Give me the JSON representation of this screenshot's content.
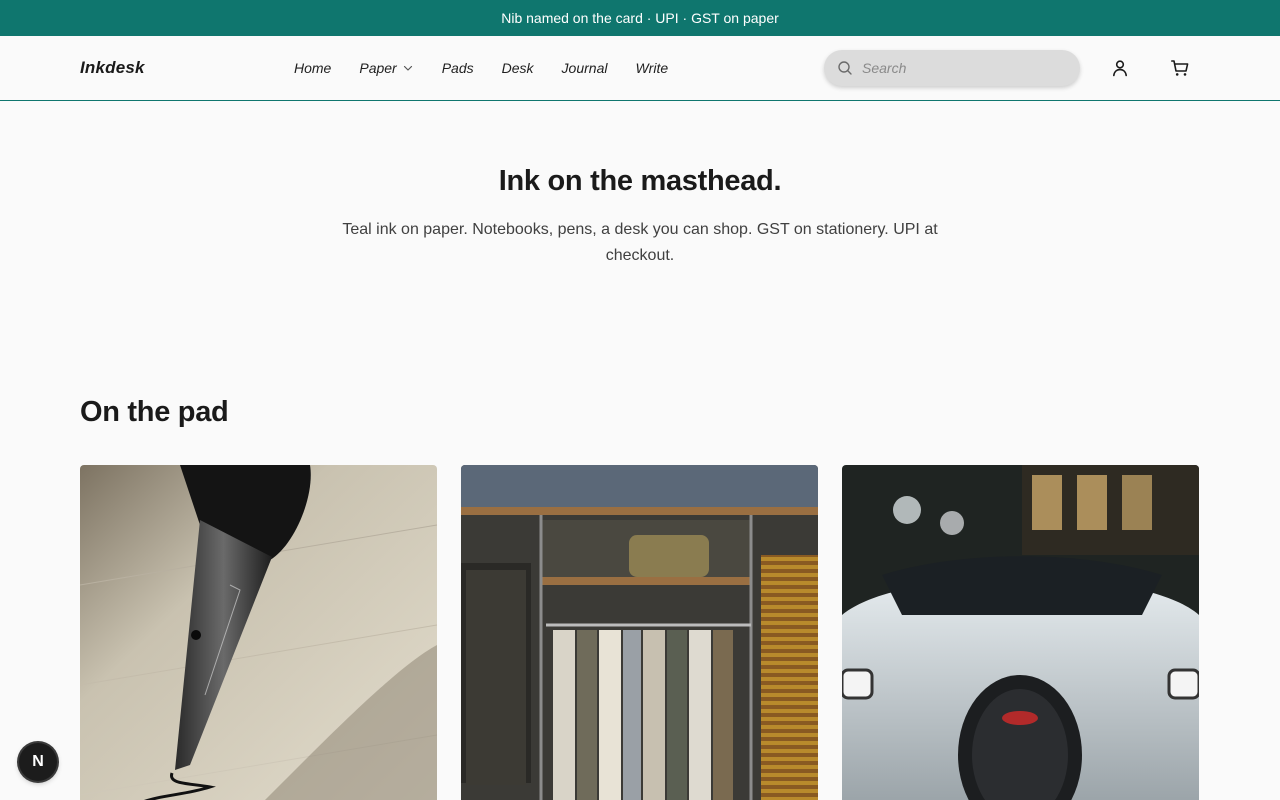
{
  "announcement": {
    "text": "Nib named on the card · UPI · GST on paper"
  },
  "header": {
    "logo": "Inkdesk",
    "nav": [
      {
        "label": "Home"
      },
      {
        "label": "Paper",
        "has_dropdown": true
      },
      {
        "label": "Pads"
      },
      {
        "label": "Desk"
      },
      {
        "label": "Journal"
      },
      {
        "label": "Write"
      }
    ],
    "search": {
      "placeholder": "Search",
      "value": ""
    },
    "icons": [
      "account-icon",
      "cart-icon"
    ]
  },
  "hero": {
    "title": "Ink on the masthead.",
    "subtitle": "Teal ink on paper. Notebooks, pens, a desk you can shop. GST on stationery. UPI at checkout."
  },
  "section": {
    "title": "On the pad",
    "cards": [
      {
        "image": "fountain-pen-nib-writing-photo"
      },
      {
        "image": "clothing-rack-shop-photo"
      },
      {
        "image": "white-sports-car-front-photo"
      }
    ]
  },
  "dev_badge": {
    "label": "N"
  },
  "colors": {
    "accent": "#0f766e",
    "background": "#fafafa",
    "search_bg": "#dcdcdc"
  }
}
